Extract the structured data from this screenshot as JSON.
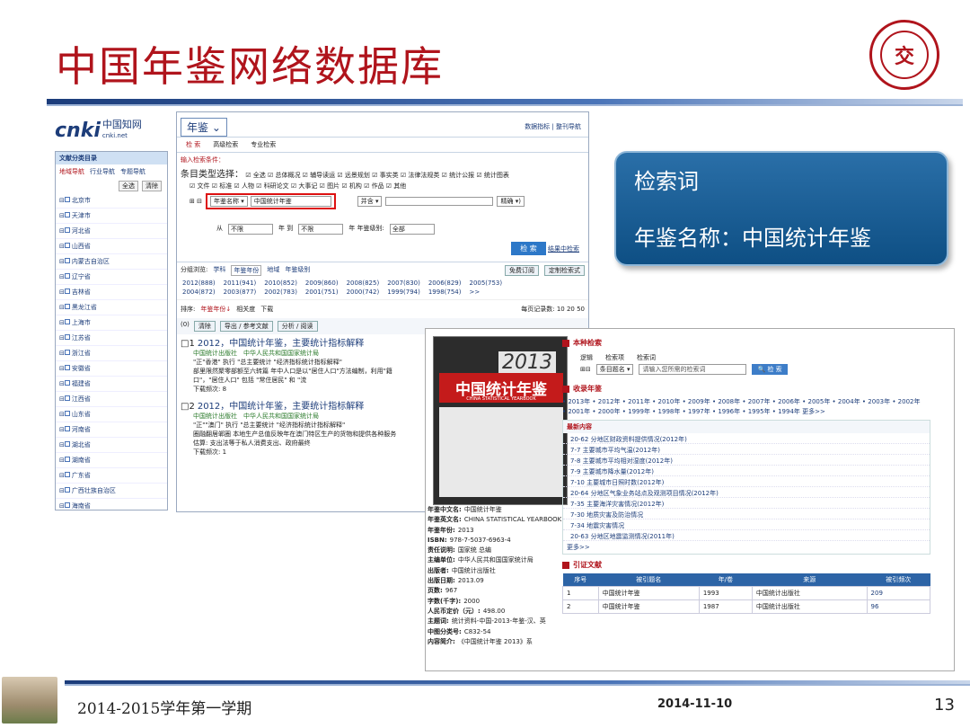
{
  "slide": {
    "title": "中国年鉴网络数据库",
    "footer_left": "2014-2015学年第一学期",
    "footer_date": "2014-11-10",
    "page_number": "13"
  },
  "callout": {
    "line1": "检索词",
    "line2": "年鉴名称：中国统计年鉴"
  },
  "cnki": {
    "logo_text": "cnki",
    "logo_cn": "中国知网",
    "logo_sub": "cnki.net",
    "db_select": "年鉴",
    "top_links": "数据指标 | 整刊导航",
    "tabs": [
      "检 索",
      "高级检索",
      "专业检索"
    ],
    "condition_label": "输入检索条件：",
    "type_label": "条目类型选择：",
    "types_row1": "☑ 全选 ☑ 总体概况 ☑ 辅导读运 ☑ 远景规划 ☑ 事实类 ☑ 法律法规类 ☑ 统计公报 ☑ 统计图表",
    "types_row2": "☑ 文件 ☑ 标准 ☑ 人物 ☑ 科研论文 ☑ 大事记 ☑ 图片 ☑ 机构 ☑ 作品 ☑ 其他",
    "field_select": "年鉴名称",
    "field_value": "中国统计年鉴",
    "and_select": "并含",
    "precise_select": "精确",
    "year_from_label": "从",
    "year_from": "不限",
    "year_to_label": "年 到",
    "year_to": "不限",
    "level_label": "年 年鉴级别:",
    "level": "全部",
    "search_btn": "检 索",
    "result_search": "结果中检索",
    "group_label": "分组浏览:",
    "group_tabs": [
      "学科",
      "年鉴年份",
      "地域",
      "年鉴级别"
    ],
    "free_sub": "免费订阅",
    "custom_search": "定制检索式",
    "years_row1": [
      "2012(888)",
      "2011(941)",
      "2010(852)",
      "2009(860)",
      "2008(825)",
      "2007(830)",
      "2006(829)",
      "2005(753)"
    ],
    "years_row2": [
      "2004(872)",
      "2003(877)",
      "2002(783)",
      "2001(751)",
      "2000(742)",
      "1999(794)",
      "1998(754)",
      ">>"
    ],
    "sort_label": "排序:",
    "sort_opts": [
      "年鉴年份↓",
      "相关度",
      "下载"
    ],
    "per_page": "每页记录数: 10 20 50",
    "sel_bar": [
      "(0)",
      "清除",
      "导出 / 参考文献",
      "分析 / 阅读"
    ],
    "results": [
      {
        "num": "1",
        "title": "2012，中国统计年鉴，主要统计指标解释",
        "src": "中国统计出版社　中华人民共和国国家统计局",
        "snip1": "\"正\"香港\" 执行 \"总主要统计 \"经济指标统计指标解释\"",
        "snip2": "部里限然聚零部额至六转篇 年中人口是以\"居住人口\"方法编制，利用\"籍",
        "snip3": "口\"，\"居住人口\" 包括 \"常住居民\" 和 \"流",
        "dl": "下载频次: 8"
      },
      {
        "num": "2",
        "title": "2012，中国统计年鉴，主要统计指标解释",
        "src": "中国统计出版社　中华人民共和国国家统计局",
        "snip1": "\"正\"\"澳门\" 执行 \"总主要统计 \"经济指标统计指标解释\"",
        "snip2": "圈融翻居郸圈 本地生产总值反映年在澳门特区生产的货物和提供各种服务",
        "snip3": "估算: 支出法等于私人消费支出、政府最终",
        "dl": "下载频次: 1"
      }
    ]
  },
  "leftnav": {
    "head": "文献分类目录",
    "tabs": [
      "地域导航",
      "行业导航",
      "专题导航"
    ],
    "btns": [
      "全选",
      "清除"
    ],
    "items": [
      "北京市",
      "天津市",
      "河北省",
      "山西省",
      "内蒙古自治区",
      "辽宁省",
      "吉林省",
      "黑龙江省",
      "上海市",
      "江苏省",
      "浙江省",
      "安徽省",
      "福建省",
      "江西省",
      "山东省",
      "河南省",
      "湖北省",
      "湖南省",
      "广东省",
      "广西壮族自治区",
      "海南省"
    ]
  },
  "detail": {
    "cover_year": "2013",
    "cover_title": "中国统计年鉴",
    "cover_en": "CHINA STATISTICAL YEARBOOK",
    "meta": [
      [
        "年鉴中文名:",
        "中国统计年鉴"
      ],
      [
        "年鉴英文名:",
        "CHINA STATISTICAL YEARBOOK"
      ],
      [
        "年鉴年份:",
        "2013"
      ],
      [
        "ISBN:",
        "978-7-5037-6963-4"
      ],
      [
        "责任说明:",
        "国家统 总编"
      ],
      [
        "主编单位:",
        "中华人民共和国国家统计局"
      ],
      [
        "出版者:",
        "中国统计出版社"
      ],
      [
        "出版日期:",
        "2013.09"
      ],
      [
        "页数:",
        "967"
      ],
      [
        "字数(千字):",
        "2000"
      ],
      [
        "人民币定价（元）:",
        "498.00"
      ],
      [
        "主题词:",
        "统计资料-中国-2013-年鉴-汉、英"
      ],
      [
        "中图分类号:",
        "C832-54"
      ],
      [
        "内容简介:",
        "《中国统计年鉴 2013》系"
      ]
    ],
    "sec_search": "本种检索",
    "logic_label": "逻辑",
    "field_label": "检索项",
    "term_label": "检索词",
    "field_value": "条目题名",
    "term_placeholder": "请输入您所需的检索词",
    "search_btn": "检 索",
    "sec_years": "收录年鉴",
    "years_line1": "• 2013年 • 2012年 • 2011年 • 2010年 • 2009年 • 2008年 • 2007年 • 2006年 • 2005年 • 2004年 • 2003年 • 2002年",
    "years_line2": "• 2001年 • 2000年 • 1999年 • 1998年 • 1997年 • 1996年 • 1995年 • 1994年 更多>>",
    "latest_head": "最新内容",
    "latest": [
      "20-62 分地区财政资料提供情况(2012年)",
      "7-7 主要城市平均气温(2012年)",
      "7-8 主要城市平均相对湿度(2012年)",
      "7-9 主要城市降水量(2012年)",
      "7-10 主要城市日照时数(2012年)",
      "20-64 分地区气象业务站点及观测项目情况(2012年)",
      "7-35 主要海洋灾害情况(2012年)",
      "7-30 地质灾害及防治情况",
      "7-34 地震灾害情况",
      "20-63 分地区地震监测情况(2011年)"
    ],
    "more": "更多>>",
    "sec_cite": "引证文献",
    "cite_headers": [
      "序号",
      "被引题名",
      "年/卷",
      "来源",
      "被引频次"
    ],
    "cite_rows": [
      [
        "1",
        "中国统计年鉴",
        "1993",
        "中国统计出版社",
        "209"
      ],
      [
        "2",
        "中国统计年鉴",
        "1987",
        "中国统计出版社",
        "96"
      ]
    ]
  }
}
